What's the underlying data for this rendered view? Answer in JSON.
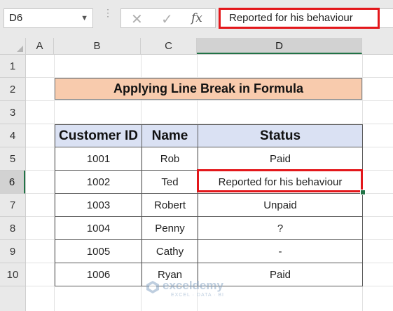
{
  "formula_bar": {
    "name_box": "D6",
    "cancel_symbol": "✕",
    "enter_symbol": "✓",
    "fx_label": "fx",
    "formula_value": "Reported for his behaviour"
  },
  "columns": [
    "A",
    "B",
    "C",
    "D"
  ],
  "rows": [
    "1",
    "2",
    "3",
    "4",
    "5",
    "6",
    "7",
    "8",
    "9",
    "10"
  ],
  "selected_cell": {
    "column": "D",
    "row": "6"
  },
  "sheet": {
    "title": "Applying Line Break in Formula",
    "headers": [
      "Customer ID",
      "Name",
      "Status"
    ],
    "records": [
      {
        "id": "1001",
        "name": "Rob",
        "status": "Paid"
      },
      {
        "id": "1002",
        "name": "Ted",
        "status": "Reported for his behaviour"
      },
      {
        "id": "1003",
        "name": "Robert",
        "status": "Unpaid"
      },
      {
        "id": "1004",
        "name": "Penny",
        "status": "?"
      },
      {
        "id": "1005",
        "name": "Cathy",
        "status": "-"
      },
      {
        "id": "1006",
        "name": "Ryan",
        "status": "Paid"
      }
    ]
  },
  "watermark": {
    "brand": "exceldemy",
    "tagline": "EXCEL · DATA · BI"
  },
  "colors": {
    "title_fill": "#f8cbad",
    "header_fill": "#dae1f3",
    "highlight_border": "#e3171b",
    "excel_green": "#217346"
  }
}
